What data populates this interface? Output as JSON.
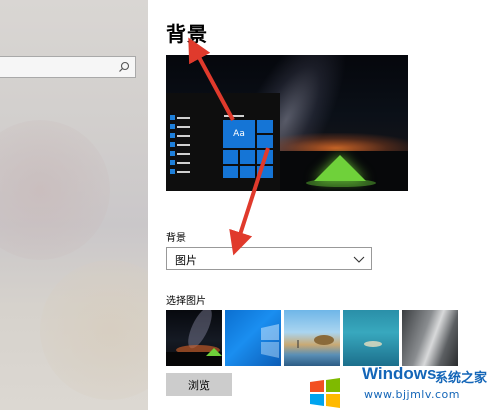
{
  "search": {
    "value": "",
    "placeholder": ""
  },
  "header": {
    "title": "背景"
  },
  "background_section": {
    "label": "背景",
    "dropdown_value": "图片"
  },
  "preview": {
    "tile_text": "Aa"
  },
  "choose_picture": {
    "label": "选择图片",
    "thumbnails": [
      {
        "name": "night-sky-tent"
      },
      {
        "name": "windows-blue"
      },
      {
        "name": "beach-sunset"
      },
      {
        "name": "underwater"
      },
      {
        "name": "rock-waterfall"
      }
    ]
  },
  "browse": {
    "label": "浏览"
  },
  "watermark": {
    "title": "Windows",
    "subtitle": "系统之家",
    "url": "www.bjjmlv.com"
  },
  "annotation_color": "#e03a2c",
  "accent_color": "#1575d6"
}
